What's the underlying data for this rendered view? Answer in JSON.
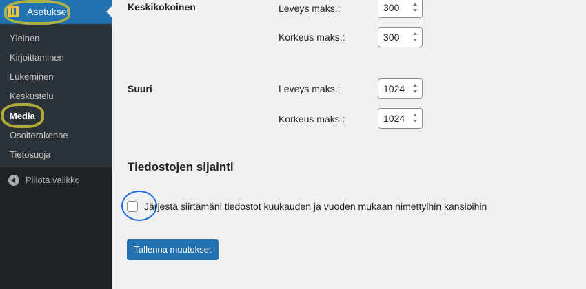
{
  "sidebar": {
    "top_item": {
      "label": "Asetukset",
      "icon": "settings-icon"
    },
    "items": [
      {
        "label": "Yleinen",
        "current": false
      },
      {
        "label": "Kirjoittaminen",
        "current": false
      },
      {
        "label": "Lukeminen",
        "current": false
      },
      {
        "label": "Keskustelu",
        "current": false
      },
      {
        "label": "Media",
        "current": true
      },
      {
        "label": "Osoiterakenne",
        "current": false
      },
      {
        "label": "Tietosuoja",
        "current": false
      }
    ],
    "collapse_label": "Piilota valikko"
  },
  "image_sizes": [
    {
      "label": "Keskikokoinen",
      "width_label": "Leveys maks.:",
      "width_value": "300",
      "height_label": "Korkeus maks.:",
      "height_value": "300"
    },
    {
      "label": "Suuri",
      "width_label": "Leveys maks.:",
      "width_value": "1024",
      "height_label": "Korkeus maks.:",
      "height_value": "1024"
    }
  ],
  "uploads": {
    "section_title": "Tiedostojen sijainti",
    "checkbox_label": "Järjestä siirtämäni tiedostot kuukauden ja vuoden mukaan nimettyihin kansioihin",
    "checked": false
  },
  "save_label": "Tallenna muutokset",
  "colors": {
    "accent": "#2271b1",
    "sidebar_bg": "#1d2327",
    "submenu_bg": "#2c3338",
    "page_bg": "#f0f0f1",
    "highlight_annotation": "#c8be32",
    "circle_annotation": "#1c6ee0"
  }
}
